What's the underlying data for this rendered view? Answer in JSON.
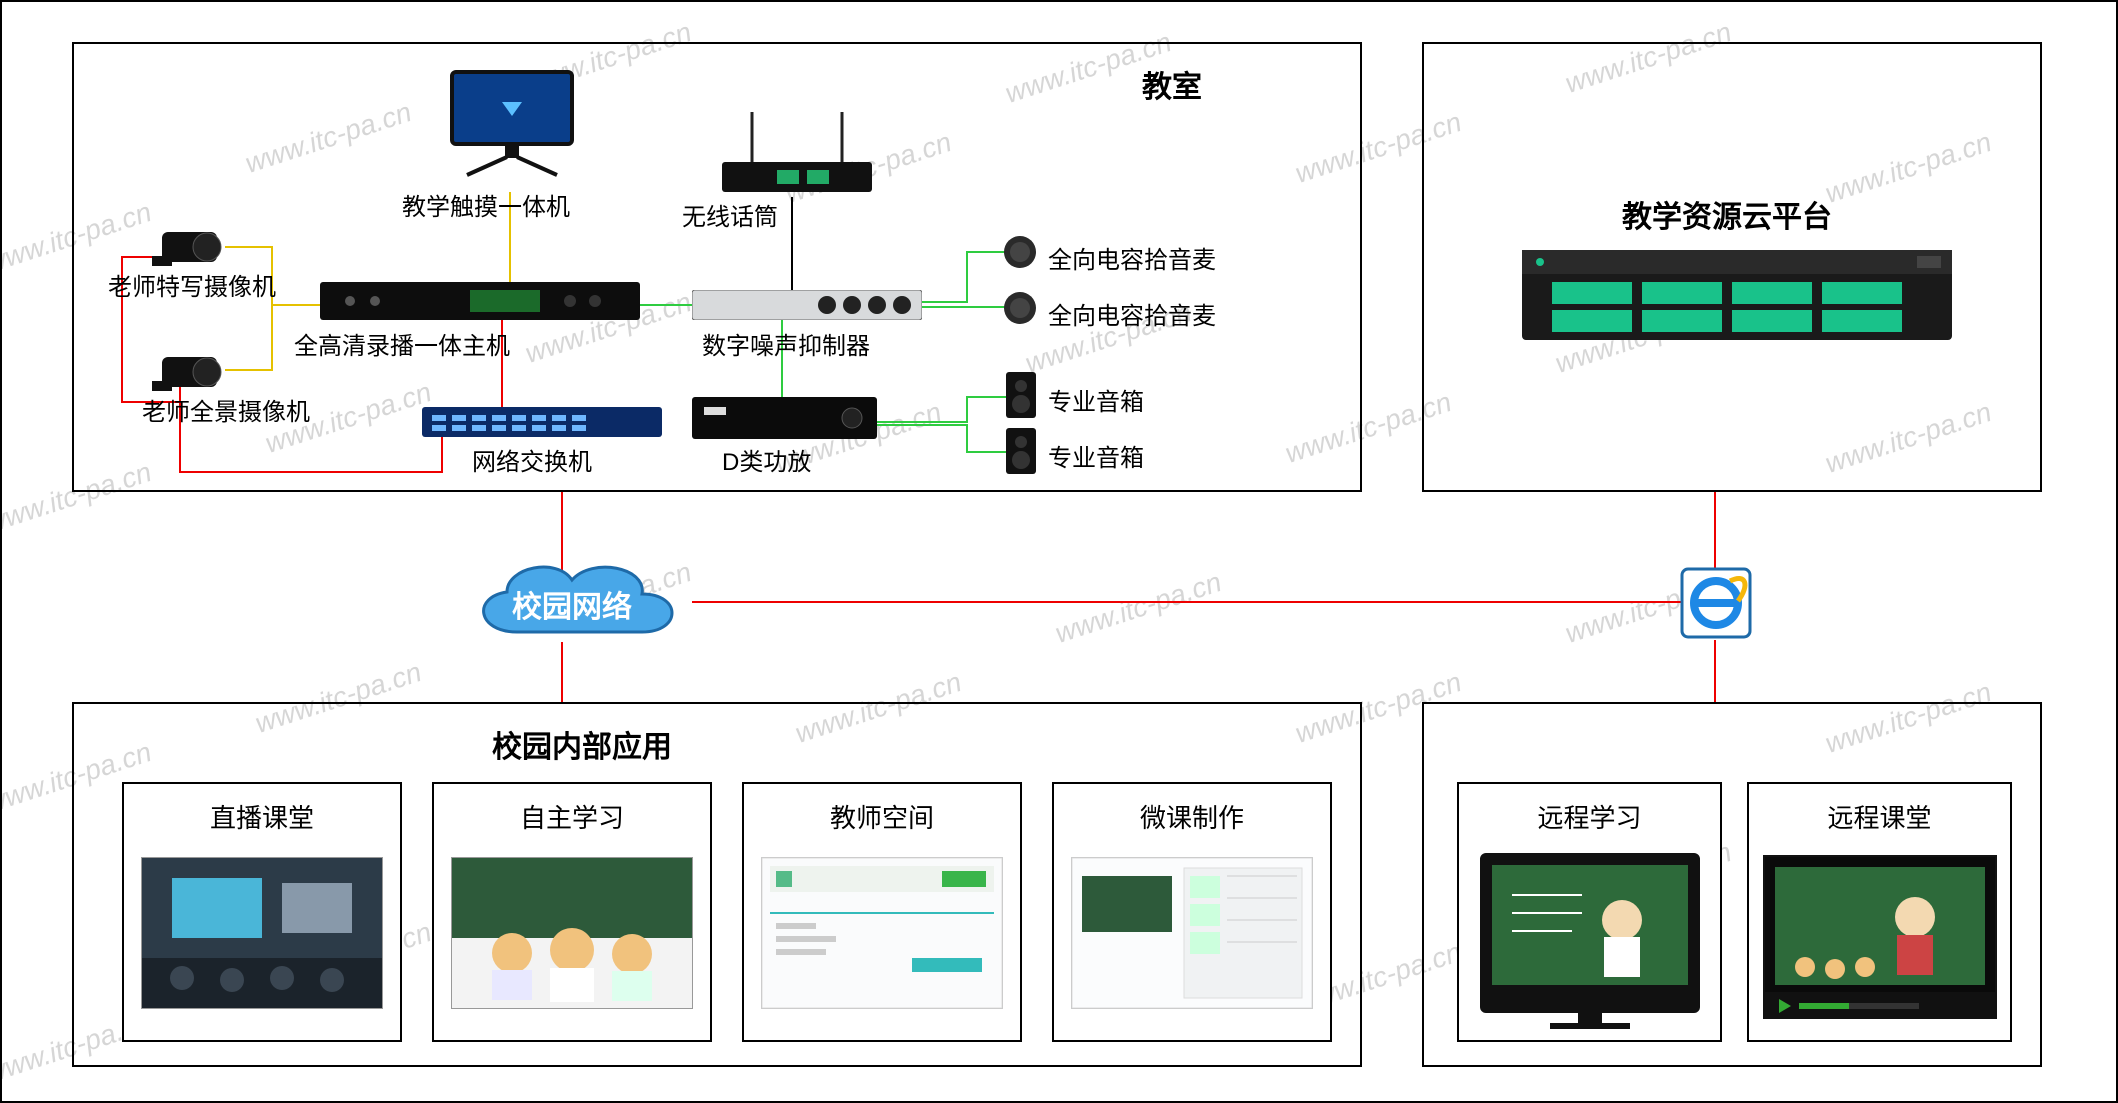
{
  "watermark": "www.itc-pa.cn",
  "classroom": {
    "title": "教室",
    "devices": {
      "touch_pc": "教学触摸一体机",
      "wireless_mic": "无线话筒",
      "teacher_close_cam": "老师特写摄像机",
      "teacher_pano_cam": "老师全景摄像机",
      "recorder_host": "全高清录播一体主机",
      "noise_suppressor": "数字噪声抑制器",
      "network_switch": "网络交换机",
      "class_d_amp": "D类功放",
      "omni_mic_1": "全向电容拾音麦",
      "omni_mic_2": "全向电容拾音麦",
      "speaker_1": "专业音箱",
      "speaker_2": "专业音箱"
    }
  },
  "cloud_platform": {
    "title": "教学资源云平台"
  },
  "network_cloud": "校园网络",
  "internal_apps": {
    "title": "校园内部应用",
    "items": [
      "直播课堂",
      "自主学习",
      "教师空间",
      "微课制作"
    ]
  },
  "remote_apps": {
    "items": [
      "远程学习",
      "远程课堂"
    ]
  }
}
